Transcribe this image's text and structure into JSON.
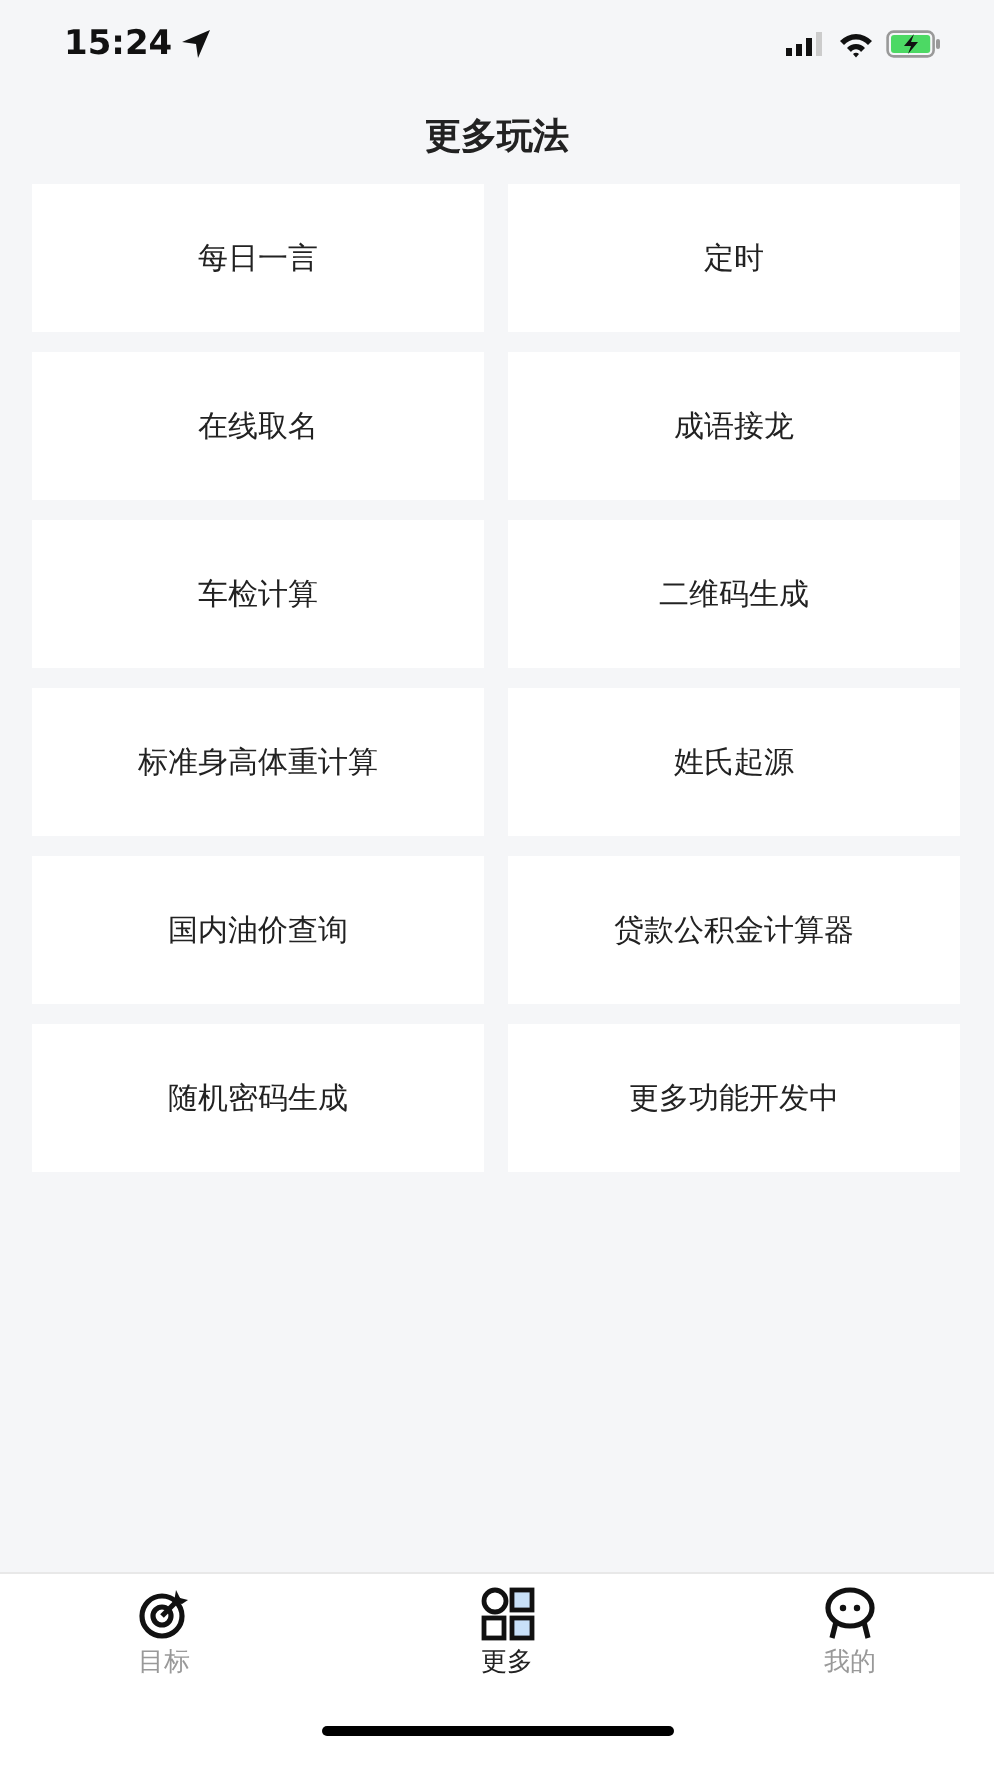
{
  "status_bar": {
    "time": "15:24"
  },
  "title": "更多玩法",
  "items": [
    {
      "label": "每日一言"
    },
    {
      "label": "定时"
    },
    {
      "label": "在线取名"
    },
    {
      "label": "成语接龙"
    },
    {
      "label": "车检计算"
    },
    {
      "label": "二维码生成"
    },
    {
      "label": "标准身高体重计算"
    },
    {
      "label": "姓氏起源"
    },
    {
      "label": "国内油价查询"
    },
    {
      "label": "贷款公积金计算器"
    },
    {
      "label": "随机密码生成"
    },
    {
      "label": "更多功能开发中"
    }
  ],
  "tab_bar": [
    {
      "label": "目标",
      "kind": "target",
      "selected": false
    },
    {
      "label": "更多",
      "kind": "grid",
      "selected": true
    },
    {
      "label": "我的",
      "kind": "face",
      "selected": false
    }
  ]
}
